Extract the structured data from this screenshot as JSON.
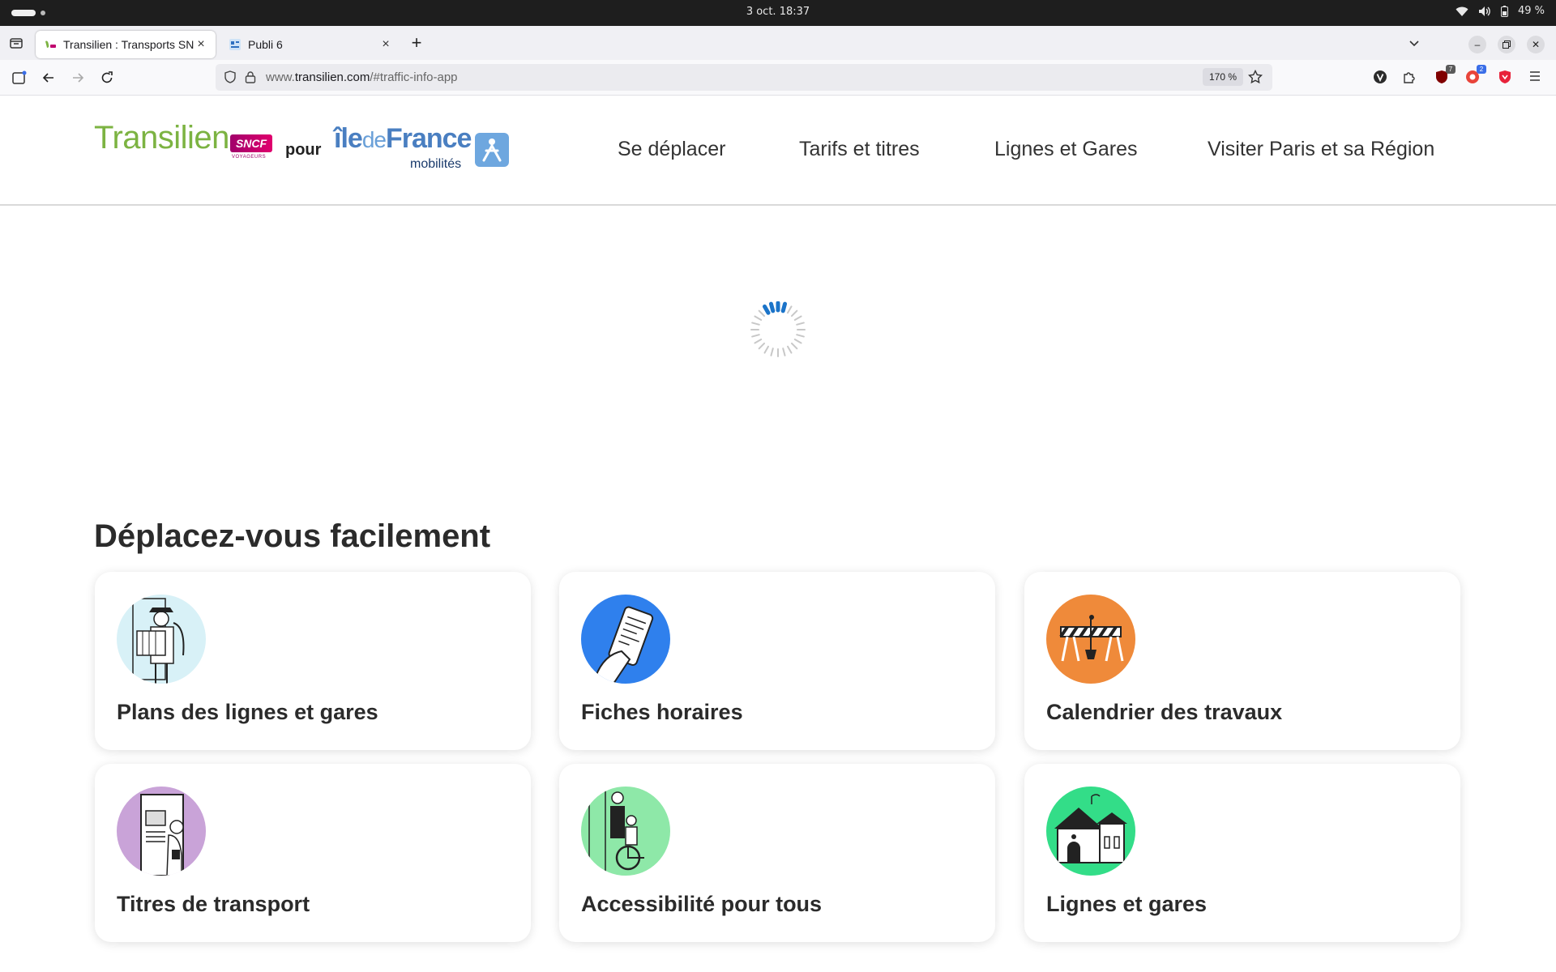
{
  "os_bar": {
    "clock": "3 oct.  18:37",
    "battery": "49 %"
  },
  "tabs": [
    {
      "title": "Transilien : Transports SNCF",
      "favicon": "transilien-favicon",
      "active": true
    },
    {
      "title": "Publi 6",
      "favicon": "publi-favicon",
      "active": false
    }
  ],
  "new_tab_label": "+",
  "urlbar": {
    "url_prefix": "www.",
    "domain": "transilien.com",
    "url_suffix": "/#traffic-info-app",
    "zoom": "170 %"
  },
  "extensions": [
    {
      "name": "v-extension-icon",
      "badge": ""
    },
    {
      "name": "puzzle-extensions-icon",
      "badge": ""
    },
    {
      "name": "ublock-icon",
      "badge": "7",
      "badge_color": "#5a5a5a"
    },
    {
      "name": "privacy-badger-icon",
      "badge": "2",
      "badge_color": "#3a6ee8"
    },
    {
      "name": "shield-red-icon",
      "badge": ""
    }
  ],
  "logo": {
    "transilien": "Transilien",
    "sncf": "SNCF",
    "voyageurs": "VOYAGEURS",
    "pour": "pour",
    "ile": "île",
    "de": "de",
    "france": "France",
    "mobilites": "mobilités"
  },
  "main_nav": [
    {
      "label": "Se déplacer"
    },
    {
      "label": "Tarifs et titres"
    },
    {
      "label": "Lignes et Gares"
    },
    {
      "label": "Visiter Paris et sa Région"
    }
  ],
  "section_title": "Déplacez-vous facilement",
  "cards": [
    {
      "label": "Plans des lignes et gares",
      "illustration": "traveler-map-illustration",
      "bg": "#d8f1f7"
    },
    {
      "label": "Fiches horaires",
      "illustration": "phone-schedule-illustration",
      "bg": "#2f80ed"
    },
    {
      "label": "Calendrier des travaux",
      "illustration": "roadworks-barrier-illustration",
      "bg": "#ef8a3a"
    },
    {
      "label": "Titres de transport",
      "illustration": "ticket-machine-illustration",
      "bg": "#c9a3d8"
    },
    {
      "label": "Accessibilité pour tous",
      "illustration": "wheelchair-assistance-illustration",
      "bg": "#8ee8a8"
    },
    {
      "label": "Lignes et gares",
      "illustration": "station-building-illustration",
      "bg": "#33dd88"
    }
  ]
}
